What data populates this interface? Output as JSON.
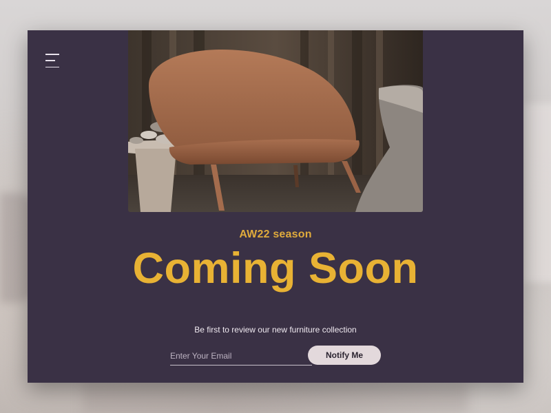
{
  "hero": {
    "eyebrow": "AW22 season",
    "title": "Coming Soon"
  },
  "signup": {
    "tagline": "Be first to review our new furniture collection",
    "email_placeholder": "Enter Your Email",
    "email_value": "",
    "button_label": "Notify Me"
  },
  "icons": {
    "menu": "hamburger-menu-icon"
  },
  "colors": {
    "card_background": "#3a3145",
    "accent": "#e8b234",
    "button_background": "#e3d9dc",
    "text_light": "#efe9f0"
  }
}
